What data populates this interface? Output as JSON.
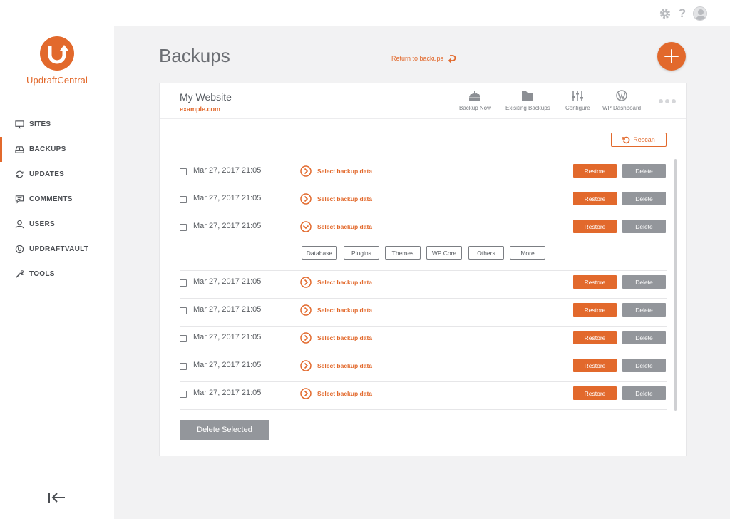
{
  "app": {
    "brand": "UpdraftCentral"
  },
  "icons": {
    "settings": "gear-icon",
    "help": "question-icon",
    "user": "user-avatar-icon",
    "add": "plus-icon",
    "collapse": "collapse-sidebar-icon"
  },
  "topbar": {
    "help_label": "?"
  },
  "sidebar": {
    "items": [
      {
        "label": "SITES",
        "icon": "monitor-icon",
        "active": false
      },
      {
        "label": "BACKUPS",
        "icon": "backup-drive-icon",
        "active": true
      },
      {
        "label": "UPDATES",
        "icon": "refresh-icon",
        "active": false
      },
      {
        "label": "COMMENTS",
        "icon": "comment-icon",
        "active": false
      },
      {
        "label": "USERS",
        "icon": "user-icon",
        "active": false
      },
      {
        "label": "UPDRAFTVAULT",
        "icon": "vault-icon",
        "active": false
      },
      {
        "label": "TOOLS",
        "icon": "wrench-icon",
        "active": false
      }
    ]
  },
  "header": {
    "title": "Backups",
    "return_label": "Return to backups"
  },
  "site": {
    "name": "My Website",
    "url": "example.com"
  },
  "site_actions": [
    {
      "label": "Backup Now",
      "icon": "backup-download-icon"
    },
    {
      "label": "Exisiting Backups",
      "icon": "folder-icon"
    },
    {
      "label": "Configure",
      "icon": "sliders-icon"
    },
    {
      "label": "WP Dashboard",
      "icon": "wordpress-icon"
    }
  ],
  "rescan_label": "Rescan",
  "backups": [
    {
      "date": "Mar 27, 2017 21:05",
      "select_label": "Select backup data",
      "expanded": false
    },
    {
      "date": "Mar 27, 2017 21:05",
      "select_label": "Select backup data",
      "expanded": false
    },
    {
      "date": "Mar 27, 2017 21:05",
      "select_label": "Select backup data",
      "expanded": true
    },
    {
      "date": "Mar 27, 2017 21:05",
      "select_label": "Select backup data",
      "expanded": false
    },
    {
      "date": "Mar 27, 2017 21:05",
      "select_label": "Select backup data",
      "expanded": false
    },
    {
      "date": "Mar 27, 2017 21:05",
      "select_label": "Select backup data",
      "expanded": false
    },
    {
      "date": "Mar 27, 2017 21:05",
      "select_label": "Select backup data",
      "expanded": false
    },
    {
      "date": "Mar 27, 2017 21:05",
      "select_label": "Select backup data",
      "expanded": false
    }
  ],
  "backup_components": [
    "Database",
    "Plugins",
    "Themes",
    "WP Core",
    "Others",
    "More"
  ],
  "row_buttons": {
    "restore": "Restore",
    "delete": "Delete"
  },
  "delete_selected_label": "Delete Selected",
  "colors": {
    "accent": "#e2692c",
    "muted_button": "#93969b",
    "background": "#f2f2f3"
  }
}
